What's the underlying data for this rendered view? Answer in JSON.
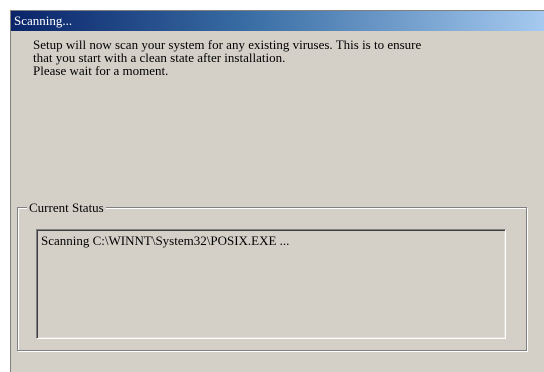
{
  "window": {
    "title": "Scanning..."
  },
  "intro": {
    "line1": "Setup will now scan your system for any existing viruses. This is to ensure",
    "line2": "that you start with a clean state after installation.",
    "line3": "Please wait for a moment."
  },
  "status_group": {
    "label": "Current Status",
    "status_text": "Scanning C:\\WINNT\\System32\\POSIX.EXE ..."
  }
}
